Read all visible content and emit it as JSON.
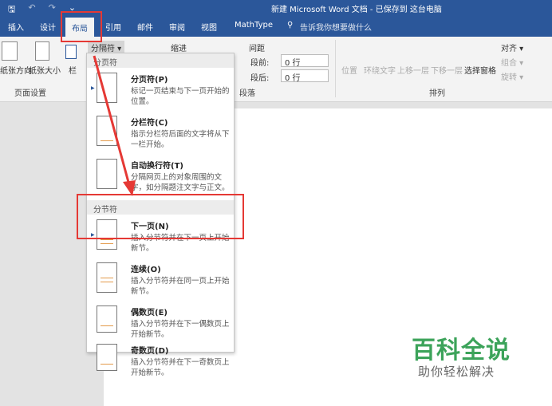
{
  "window": {
    "title": "新建 Microsoft Word 文档 - 已保存到 这台电脑"
  },
  "qat": {
    "save": "🖫",
    "undo": "↶",
    "redo": "↷",
    "more": "⌄"
  },
  "tabs": [
    "插入",
    "设计",
    "布局",
    "引用",
    "邮件",
    "审阅",
    "视图",
    "MathType"
  ],
  "search": {
    "placeholder": "告诉我你想要做什么"
  },
  "ribbon": {
    "page_setup": {
      "orientation": "纸张方向",
      "size": "纸张大小",
      "columns": "栏",
      "breaks": "分隔符 ▾",
      "label": "页面设置"
    },
    "paragraph": {
      "indent": "缩进",
      "spacing": "间距",
      "before_label": "段前:",
      "before_value": "0 行",
      "after_label": "段后:",
      "after_value": "0 行",
      "label": "段落"
    },
    "arrange": {
      "position": "位置",
      "wrap": "环绕文字",
      "forward": "上移一层",
      "backward": "下移一层",
      "pane": "选择窗格",
      "align": "对齐 ▾",
      "group": "组合 ▾",
      "rotate": "旋转 ▾",
      "label": "排列"
    }
  },
  "menu": {
    "page_breaks_header": "分页符",
    "section_breaks_header": "分节符",
    "page_items": [
      {
        "title": "分页符(P)",
        "desc": "标记一页结束与下一页开始的位置。"
      },
      {
        "title": "分栏符(C)",
        "desc": "指示分栏符后面的文字将从下一栏开始。"
      },
      {
        "title": "自动换行符(T)",
        "desc": "分隔网页上的对象周围的文字，如分隔题注文字与正文。"
      }
    ],
    "section_items": [
      {
        "title": "下一页(N)",
        "desc": "插入分节符并在下一页上开始新节。"
      },
      {
        "title": "连续(O)",
        "desc": "插入分节符并在同一页上开始新节。"
      },
      {
        "title": "偶数页(E)",
        "desc": "插入分节符并在下一偶数页上开始新节。"
      },
      {
        "title": "奇数页(D)",
        "desc": "插入分节符并在下一奇数页上开始新节。"
      }
    ]
  },
  "watermark": {
    "brand": "百科全说",
    "slogan": "助你轻松解决"
  },
  "colors": {
    "accent": "#2b579a",
    "highlight": "#e53935",
    "watermark": "#3ca35a"
  }
}
